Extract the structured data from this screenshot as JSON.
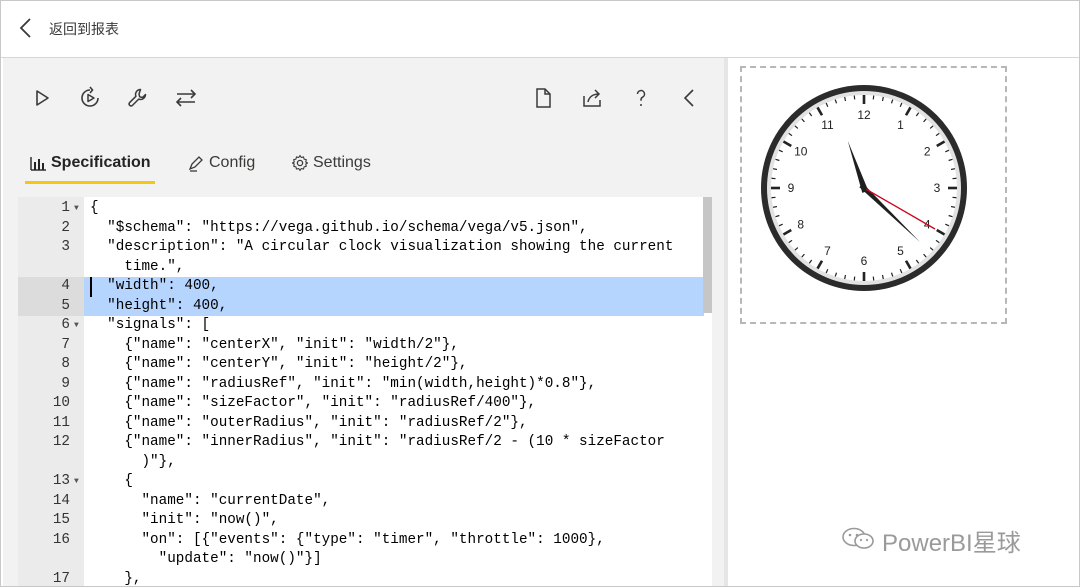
{
  "header": {
    "back_label": "返回到报表"
  },
  "toolbar": {
    "left_icons": [
      "play-icon",
      "play-circle-icon",
      "wrench-icon",
      "swap-icon"
    ],
    "right_icons": [
      "document-icon",
      "share-icon",
      "help-icon",
      "collapse-chevron-icon"
    ]
  },
  "tabs": [
    {
      "label": "Specification",
      "icon": "bar-chart-icon",
      "active": true
    },
    {
      "label": "Config",
      "icon": "pen-icon",
      "active": false
    },
    {
      "label": "Settings",
      "icon": "gear-icon",
      "active": false
    }
  ],
  "colors": {
    "accent": "#f2c811",
    "selection": "#b5d5ff",
    "gutter": "#ebebeb"
  },
  "code": [
    {
      "n": "1",
      "fold": true,
      "text": "{"
    },
    {
      "n": "2",
      "text": "  \"$schema\": \"https://vega.github.io/schema/vega/v5.json\","
    },
    {
      "n": "3",
      "text": "  \"description\": \"A circular clock visualization showing the current"
    },
    {
      "n": "",
      "text": "    time.\","
    },
    {
      "n": "4",
      "text": "  \"width\": 400,",
      "selected": true
    },
    {
      "n": "5",
      "text": "  \"height\": 400,",
      "selected": true
    },
    {
      "n": "6",
      "fold": true,
      "text": "  \"signals\": ["
    },
    {
      "n": "7",
      "text": "    {\"name\": \"centerX\", \"init\": \"width/2\"},"
    },
    {
      "n": "8",
      "text": "    {\"name\": \"centerY\", \"init\": \"height/2\"},"
    },
    {
      "n": "9",
      "text": "    {\"name\": \"radiusRef\", \"init\": \"min(width,height)*0.8\"},"
    },
    {
      "n": "10",
      "text": "    {\"name\": \"sizeFactor\", \"init\": \"radiusRef/400\"},"
    },
    {
      "n": "11",
      "text": "    {\"name\": \"outerRadius\", \"init\": \"radiusRef/2\"},"
    },
    {
      "n": "12",
      "text": "    {\"name\": \"innerRadius\", \"init\": \"radiusRef/2 - (10 * sizeFactor"
    },
    {
      "n": "",
      "text": "      )\"},"
    },
    {
      "n": "13",
      "fold": true,
      "text": "    {"
    },
    {
      "n": "14",
      "text": "      \"name\": \"currentDate\","
    },
    {
      "n": "15",
      "text": "      \"init\": \"now()\","
    },
    {
      "n": "16",
      "text": "      \"on\": [{\"events\": {\"type\": \"timer\", \"throttle\": 1000},"
    },
    {
      "n": "",
      "text": "        \"update\": \"now()\"}]"
    },
    {
      "n": "17",
      "text": "    },"
    }
  ],
  "clock": {
    "numbers": [
      "12",
      "1",
      "2",
      "3",
      "4",
      "5",
      "6",
      "7",
      "8",
      "9",
      "10",
      "11"
    ],
    "time": {
      "hour": 11,
      "minute": 22,
      "second": 20
    },
    "colors": {
      "rim": "#2b2b2b",
      "face": "#ffffff",
      "hands": "#1f1f1f",
      "second_hand": "#d0021b"
    }
  },
  "watermark": {
    "text": "PowerBI星球"
  }
}
